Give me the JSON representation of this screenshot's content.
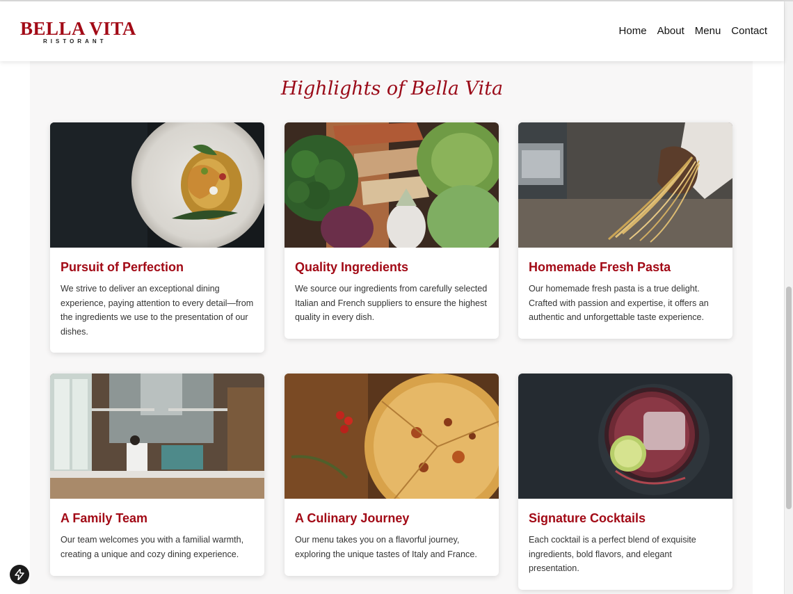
{
  "brand": {
    "name": "BELLA VITA",
    "tagline": "RISTORANT"
  },
  "nav": {
    "items": [
      "Home",
      "About",
      "Menu",
      "Contact"
    ]
  },
  "section": {
    "title": "Highlights of Bella Vita"
  },
  "cards": [
    {
      "title": "Pursuit of Perfection",
      "text": "We strive to deliver an exceptional dining experience, paying attention to every detail—from the ingredients we use to the presentation of our dishes.",
      "image": "pasta-dish-image"
    },
    {
      "title": "Quality Ingredients",
      "text": "We source our ingredients from carefully selected Italian and French suppliers to ensure the highest quality in every dish.",
      "image": "vegetables-image"
    },
    {
      "title": "Homemade Fresh Pasta",
      "text": "Our homemade fresh pasta is a true delight. Crafted with passion and expertise, it offers an authentic and unforgettable taste experience.",
      "image": "fresh-pasta-image"
    },
    {
      "title": "A Family Team",
      "text": "Our team welcomes you with a familial warmth, creating a unique and cozy dining experience.",
      "image": "kitchen-image"
    },
    {
      "title": "A Culinary Journey",
      "text": "Our menu takes you on a flavorful journey, exploring the unique tastes of Italy and France.",
      "image": "pizza-image"
    },
    {
      "title": "Signature Cocktails",
      "text": "Each cocktail is a perfect blend of exquisite ingredients, bold flavors, and elegant presentation.",
      "image": "cocktail-image"
    }
  ],
  "colors": {
    "accent": "#a20a16",
    "section_bg": "#f8f7f7"
  }
}
